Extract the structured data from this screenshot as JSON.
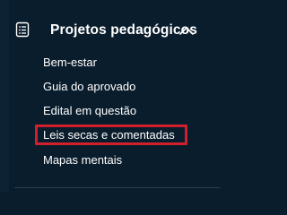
{
  "sidebar": {
    "section": {
      "title": "Projetos pedagógicos",
      "icon": "list-document-icon",
      "expanded": true,
      "toggle_icon": "chevron-up-icon"
    },
    "items": [
      {
        "label": "Bem-estar"
      },
      {
        "label": "Guia do aprovado"
      },
      {
        "label": "Edital em questão"
      },
      {
        "label": "Leis secas e comentadas"
      },
      {
        "label": "Mapas mentais"
      }
    ]
  },
  "colors": {
    "background": "#0a1d2c",
    "text": "#ffffff",
    "highlight": "#d11f2b"
  }
}
